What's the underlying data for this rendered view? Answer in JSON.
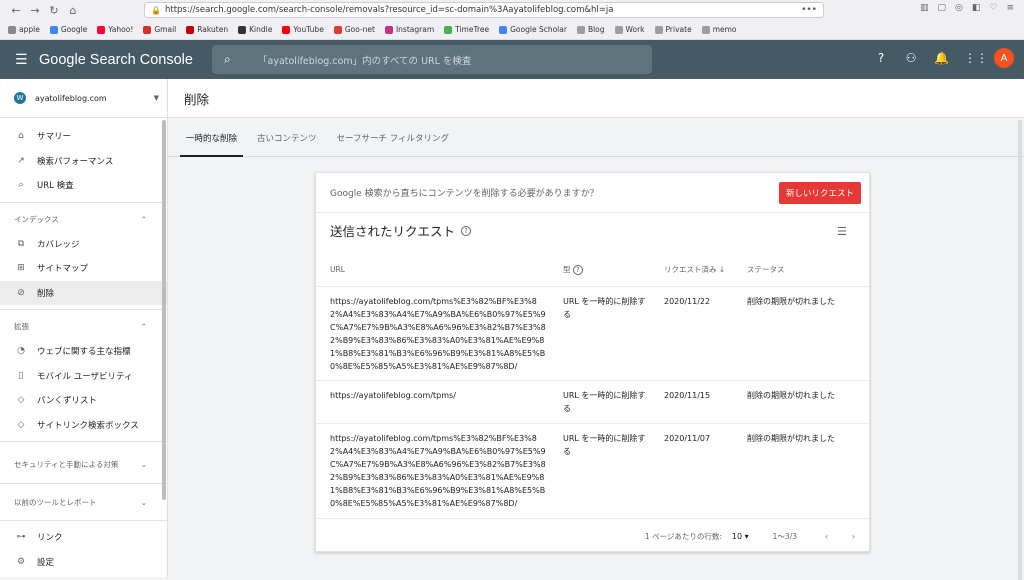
{
  "browser": {
    "back": "←",
    "forward": "→",
    "reload": "↻",
    "home": "⌂",
    "url": "https://search.google.com/search-console/removals?resource_id=sc-domain%3Aayatolifeblog.com&hl=ja",
    "more": "•••"
  },
  "bookmarks": [
    {
      "label": "apple",
      "color": "#888888"
    },
    {
      "label": "Google",
      "color": "#4285f4"
    },
    {
      "label": "Yahoo!",
      "color": "#ff0033"
    },
    {
      "label": "Gmail",
      "color": "#d93025"
    },
    {
      "label": "Rakuten",
      "color": "#bf0000"
    },
    {
      "label": "Kindle",
      "color": "#333333"
    },
    {
      "label": "YouTube",
      "color": "#ff0000"
    },
    {
      "label": "Goo-net",
      "color": "#e53935"
    },
    {
      "label": "Instagram",
      "color": "#c13584"
    },
    {
      "label": "TimeTree",
      "color": "#4caf50"
    },
    {
      "label": "Google Scholar",
      "color": "#4285f4"
    },
    {
      "label": "Blog",
      "color": "#9e9e9e"
    },
    {
      "label": "Work",
      "color": "#9e9e9e"
    },
    {
      "label": "Private",
      "color": "#9e9e9e"
    },
    {
      "label": "memo",
      "color": "#9e9e9e"
    }
  ],
  "topbar": {
    "app_title": "Google Search Console",
    "search_placeholder": "「ayatolifeblog.com」内のすべての URL を検査",
    "avatar_letter": "A"
  },
  "sidebar": {
    "property": "ayatolifeblog.com",
    "items_top": [
      {
        "label": "サマリー",
        "icon": "⌂"
      },
      {
        "label": "検索パフォーマンス",
        "icon": "↗"
      },
      {
        "label": "URL 検査",
        "icon": "⌕"
      }
    ],
    "index_label": "インデックス",
    "index_items": [
      {
        "label": "カバレッジ",
        "icon": "⧉"
      },
      {
        "label": "サイトマップ",
        "icon": "⊞"
      },
      {
        "label": "削除",
        "icon": "⊘"
      }
    ],
    "ext_label": "拡張",
    "ext_items": [
      {
        "label": "ウェブに関する主な指標",
        "icon": "◔"
      },
      {
        "label": "モバイル ユーザビリティ",
        "icon": "▯"
      },
      {
        "label": "パンくずリスト",
        "icon": "◇"
      },
      {
        "label": "サイトリンク検索ボックス",
        "icon": "◇"
      }
    ],
    "security_label": "セキュリティと手動による対策",
    "legacy_label": "以前のツールとレポート",
    "bottom_items": [
      {
        "label": "リンク",
        "icon": "⊶"
      },
      {
        "label": "設定",
        "icon": "⚙"
      }
    ]
  },
  "main": {
    "title": "削除",
    "tabs": [
      "一時的な削除",
      "古いコンテンツ",
      "セーフサーチ フィルタリング"
    ],
    "banner_text": "Google 検索から直ちにコンテンツを削除する必要がありますか？",
    "new_request": "新しいリクエスト",
    "section_title": "送信されたリクエスト",
    "columns": {
      "url": "URL",
      "type": "型",
      "date": "リクエスト済み",
      "status": "ステータス"
    },
    "rows": [
      {
        "url": "https://ayatolifeblog.com/tpms%E3%82%BF%E3%82%A4%E3%83%A4%E7%A9%BA%E6%B0%97%E5%9C%A7%E7%9B%A3%E8%A6%96%E3%82%B7%E3%82%B9%E3%83%86%E3%83%A0%E3%81%AE%E9%81%B8%E3%81%B3%E6%96%B9%E3%81%A8%E5%B0%8E%E5%85%A5%E3%81%AE%E9%87%8D/",
        "type": "URL を一時的に削除する",
        "date": "2020/11/22",
        "status": "削除の期限が切れました"
      },
      {
        "url": "https://ayatolifeblog.com/tpms/",
        "type": "URL を一時的に削除する",
        "date": "2020/11/15",
        "status": "削除の期限が切れました"
      },
      {
        "url": "https://ayatolifeblog.com/tpms%E3%82%BF%E3%82%A4%E3%83%A4%E7%A9%BA%E6%B0%97%E5%9C%A7%E7%9B%A3%E8%A6%96%E3%82%B7%E3%82%B9%E3%83%86%E3%83%A0%E3%81%AE%E9%81%B8%E3%81%B3%E6%96%B9%E3%81%A8%E5%B0%8E%E5%85%A5%E3%81%AE%E9%87%8D/",
        "type": "URL を一時的に削除する",
        "date": "2020/11/07",
        "status": "削除の期限が切れました"
      }
    ],
    "pager": {
      "rows_label": "1 ページあたりの行数:",
      "rows_value": "10",
      "range": "1〜3/3"
    }
  }
}
